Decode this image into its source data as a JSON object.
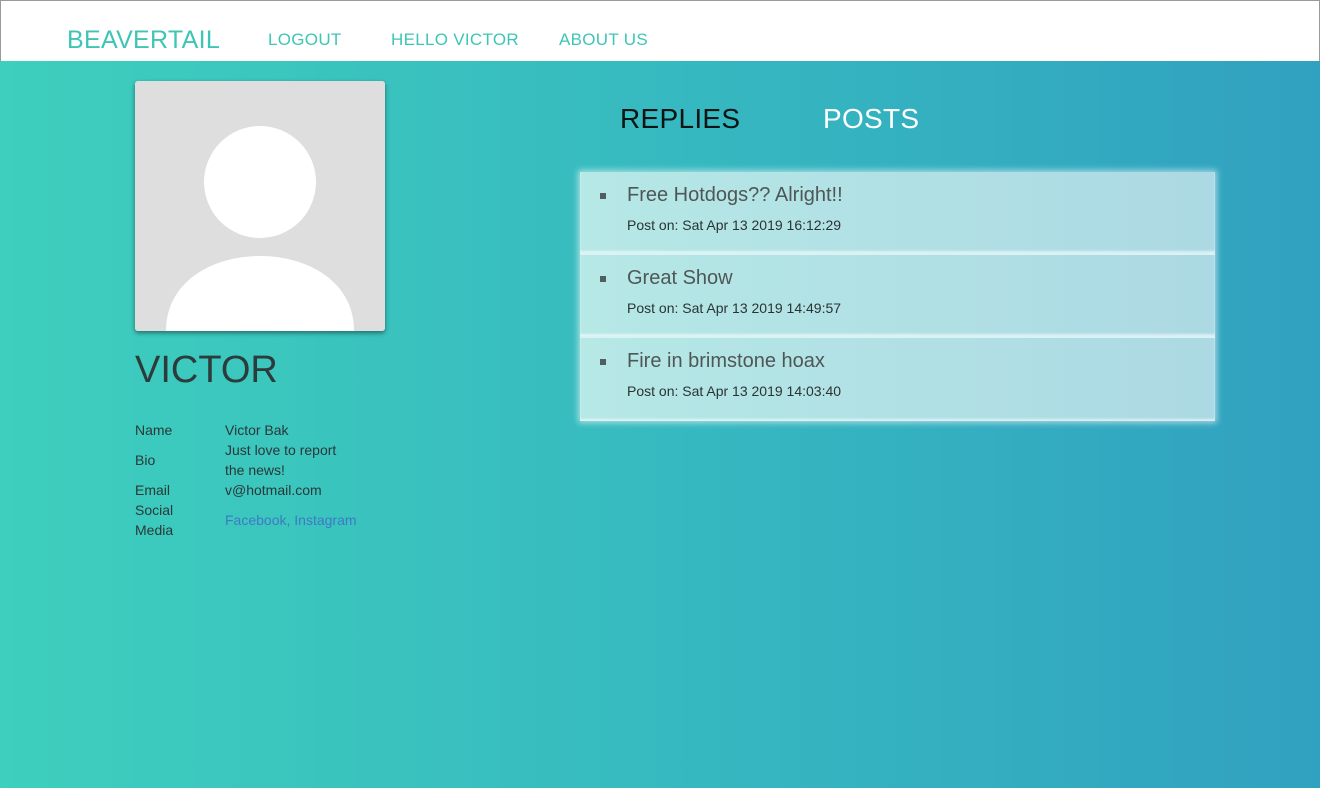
{
  "navbar": {
    "brand": "BEAVERTAIL",
    "logout": "LOGOUT",
    "hello": "HELLO VICTOR",
    "about": "ABOUT US"
  },
  "profile": {
    "avatar_icon": "default-user-silhouette",
    "display_name": "VICTOR",
    "fields": {
      "name_label": "Name",
      "name_value": "Victor Bak",
      "bio_label": "Bio",
      "bio_value": "Just love to report the news!",
      "email_label": "Email",
      "email_value": "v@hotmail.com",
      "social_label": "Social Media",
      "social_facebook": "Facebook",
      "social_separator": ", ",
      "social_instagram": "Instagram"
    }
  },
  "tabs": {
    "replies": "REPLIES",
    "posts": "POSTS"
  },
  "posts": [
    {
      "title": "Free Hotdogs?? Alright!!",
      "date": "Post on: Sat Apr 13 2019 16:12:29"
    },
    {
      "title": "Great Show",
      "date": "Post on: Sat Apr 13 2019 14:49:57"
    },
    {
      "title": "Fire in brimstone hoax",
      "date": "Post on: Sat Apr 13 2019 14:03:40"
    }
  ],
  "colors": {
    "brand": "#3ec5b6",
    "background_start": "#3ecfbd",
    "background_end": "#31a1c0",
    "link": "#3f79c4"
  }
}
